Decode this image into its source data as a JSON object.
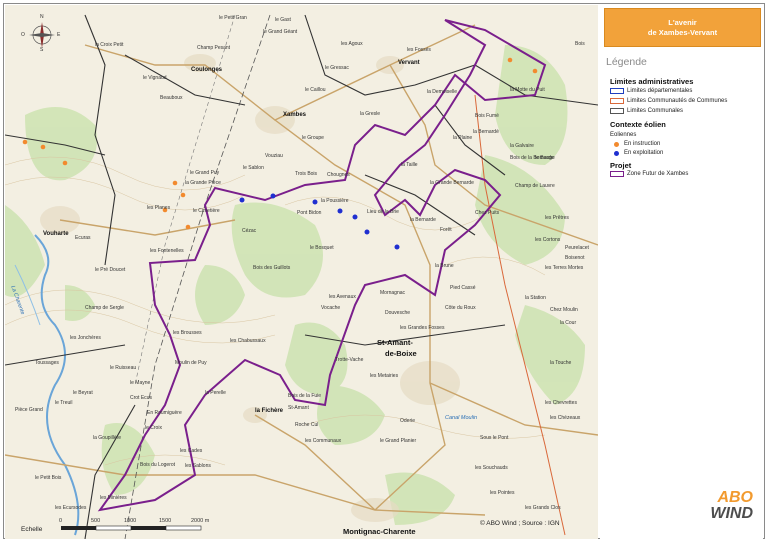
{
  "title": {
    "line1": "L'avenir",
    "line2": "de Xambes-Vervant",
    "background": "#f2a23a"
  },
  "legend": {
    "heading": "Légende",
    "sections": [
      {
        "title": "Limites administratives",
        "items": [
          {
            "label": "Limites départementales",
            "color": "#1f3fbf"
          },
          {
            "label": "Limites Communautés de Communes",
            "color": "#d9683a"
          },
          {
            "label": "Limites Communales",
            "color": "#555555"
          }
        ]
      },
      {
        "title": "Contexte éolien",
        "subtitle": "Eoliennes",
        "items": [
          {
            "label": "En instruction",
            "color": "#f28a2e"
          },
          {
            "label": "En exploitation",
            "color": "#1f2fd0"
          }
        ]
      },
      {
        "title": "Projet",
        "items": [
          {
            "label": "Zone Futur de Xambes",
            "color": "#7a1f8c"
          }
        ]
      }
    ]
  },
  "logo": {
    "line1": "ABO",
    "line2": "WIND"
  },
  "scale": {
    "label": "Echelle",
    "ticks": [
      "0",
      "500",
      "1000",
      "1500",
      "2000 m"
    ]
  },
  "compass": {
    "n": "N",
    "s": "S",
    "e": "E",
    "o": "O"
  },
  "copyright": "© ABO Wind ; Source : IGN",
  "map_labels": {
    "towns": [
      "Coulonges",
      "Xambes",
      "Vervant",
      "Vouharte",
      "St-Amant-",
      "de-Boixe",
      "la Fichère",
      "Montignac-Charente"
    ],
    "places": [
      "le Petit Gran",
      "le Grand Géant",
      "le Gast",
      "Champ Pesant",
      "la Croix Petit",
      "le Vignaud",
      "Beauboux",
      "les Agoux",
      "le Gressac",
      "le Caillou",
      "la Gresle",
      "le Groupe",
      "les Fossés",
      "la Demoiselle",
      "la Motte du Puit",
      "Bois Fumé",
      "la Bernardé",
      "Chougnes",
      "le Sablon",
      "Trois Bois",
      "Vouziau",
      "la Plaine",
      "la Taille",
      "la Grande Bernarde",
      "le Grand Puy",
      "la Bernarde",
      "Forêt",
      "Chez Puits",
      "Champ de Lauvre",
      "le Bauge",
      "les Prêtres",
      "les Cortons",
      "la Galvaire",
      "Bois de la Bernarde",
      "les Terres Mortes",
      "le Cimetière",
      "Pont Bidon",
      "la Poussière",
      "Lieu de la Brie",
      "Cézac",
      "Bois des Guillots",
      "le Bosquet",
      "Vocache",
      "les Avenaux",
      "Mornagnac",
      "Douvesche",
      "la Brune",
      "les Grandes Fosses",
      "Côte du Roux",
      "Pied Cassé",
      "les Brousses",
      "les Chabussaux",
      "les Fontenelles",
      "les Planes",
      "la Grande Pièce",
      "Ecuras",
      "le Pré Doucet",
      "Champ de Sergle",
      "les Jonchères",
      "Toussages",
      "le Treuil",
      "le Beyrat",
      "Pièce Grand",
      "Moulin de Puy",
      "le Mayne",
      "Crot Ecus",
      "En Roumiguère",
      "la Goupillère",
      "le Croix",
      "les Cades",
      "Bois du Logerot",
      "les Sablons",
      "les Ecursodes",
      "le Petit Bois",
      "les Minières",
      "la Perelle",
      "Trotte-Vache",
      "les Metairies",
      "Bois de la Fuie",
      "St-Amant",
      "Roche Cul",
      "les Communaux",
      "le Grand Planier",
      "Oderie",
      "Sous le Pont",
      "les Souchauds",
      "les Grands Clos",
      "les Pointes",
      "Peurelacet",
      "Boisenot",
      "la Station",
      "Chez Moulin",
      "la Cour",
      "les Chevrettes",
      "les Chézeaux",
      "Bois",
      "la Touche",
      "le Ruisseau"
    ]
  },
  "rivers": [
    "La Charente",
    "Canal Moulin"
  ]
}
